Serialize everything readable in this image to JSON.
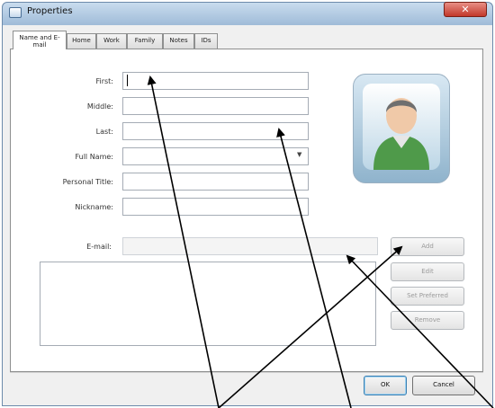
{
  "window": {
    "title": "Properties"
  },
  "tabs": [
    {
      "label": "Name and E-mail",
      "active": true
    },
    {
      "label": "Home"
    },
    {
      "label": "Work"
    },
    {
      "label": "Family"
    },
    {
      "label": "Notes"
    },
    {
      "label": "IDs"
    }
  ],
  "name_fields": [
    {
      "label": "First:",
      "value": ""
    },
    {
      "label": "Middle:",
      "value": ""
    },
    {
      "label": "Last:",
      "value": ""
    },
    {
      "label": "Full Name:",
      "value": ""
    },
    {
      "label": "Personal Title:",
      "value": ""
    },
    {
      "label": "Nickname:",
      "value": ""
    }
  ],
  "email": {
    "label": "E-mail:",
    "value": ""
  },
  "email_buttons": {
    "add": "Add",
    "edit": "Edit",
    "set_preferred": "Set Preferred",
    "remove": "Remove"
  },
  "footer": {
    "ok": "OK",
    "cancel": "Cancel"
  },
  "colors": {
    "titlebar": "#b6cde3",
    "close": "#c2382a",
    "accent_button": "#3c7fb1",
    "annotation_arrows": "#000000"
  },
  "icons": {
    "avatar": "contact-avatar-icon",
    "close": "close-icon",
    "app": "contact-card-icon"
  }
}
